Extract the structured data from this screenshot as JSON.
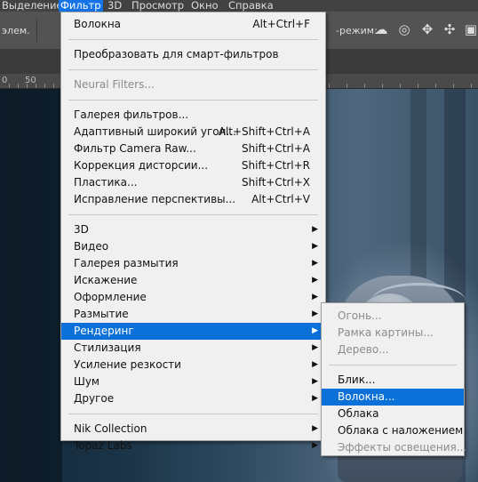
{
  "menubar": {
    "items": [
      "Выделение",
      "Фильтр",
      "3D",
      "Просмотр",
      "Окно",
      "Справка"
    ]
  },
  "options_bar": {
    "left_text": "элем.",
    "right_text": "-режим:",
    "icons": [
      "orbit-icon",
      "roll-icon",
      "pan-icon",
      "slide-icon",
      "scale-icon"
    ]
  },
  "ruler": {
    "labels": [
      "50",
      "0"
    ]
  },
  "filter_menu": {
    "groups": [
      [
        {
          "label": "Волокна",
          "shortcut": "Alt+Ctrl+F"
        }
      ],
      [
        {
          "label": "Преобразовать для смарт-фильтров"
        }
      ],
      [
        {
          "label": "Neural Filters...",
          "disabled": true
        }
      ],
      [
        {
          "label": "Галерея фильтров..."
        },
        {
          "label": "Адаптивный широкий угол...",
          "shortcut": "Alt+Shift+Ctrl+A"
        },
        {
          "label": "Фильтр Camera Raw...",
          "shortcut": "Shift+Ctrl+A"
        },
        {
          "label": "Коррекция дисторсии...",
          "shortcut": "Shift+Ctrl+R"
        },
        {
          "label": "Пластика...",
          "shortcut": "Shift+Ctrl+X"
        },
        {
          "label": "Исправление перспективы...",
          "shortcut": "Alt+Ctrl+V"
        }
      ],
      [
        {
          "label": "3D",
          "submenu": true
        },
        {
          "label": "Видео",
          "submenu": true
        },
        {
          "label": "Галерея размытия",
          "submenu": true
        },
        {
          "label": "Искажение",
          "submenu": true
        },
        {
          "label": "Оформление",
          "submenu": true
        },
        {
          "label": "Размытие",
          "submenu": true
        },
        {
          "label": "Рендеринг",
          "submenu": true,
          "highlighted": true
        },
        {
          "label": "Стилизация",
          "submenu": true
        },
        {
          "label": "Усиление резкости",
          "submenu": true
        },
        {
          "label": "Шум",
          "submenu": true
        },
        {
          "label": "Другое",
          "submenu": true
        }
      ],
      [
        {
          "label": "Nik Collection",
          "submenu": true
        },
        {
          "label": "Topaz Labs",
          "submenu": true
        }
      ]
    ]
  },
  "render_submenu": {
    "groups": [
      [
        {
          "label": "Огонь...",
          "disabled": true
        },
        {
          "label": "Рамка картины...",
          "disabled": true
        },
        {
          "label": "Дерево...",
          "disabled": true
        }
      ],
      [
        {
          "label": "Блик..."
        },
        {
          "label": "Волокна...",
          "highlighted": true
        },
        {
          "label": "Облака"
        },
        {
          "label": "Облака с наложением"
        },
        {
          "label": "Эффекты освещения...",
          "disabled": true
        }
      ]
    ]
  },
  "colors": {
    "highlight": "#0b71d9",
    "menu_bg": "#f0f0f0",
    "menubar_bg": "#424242"
  }
}
